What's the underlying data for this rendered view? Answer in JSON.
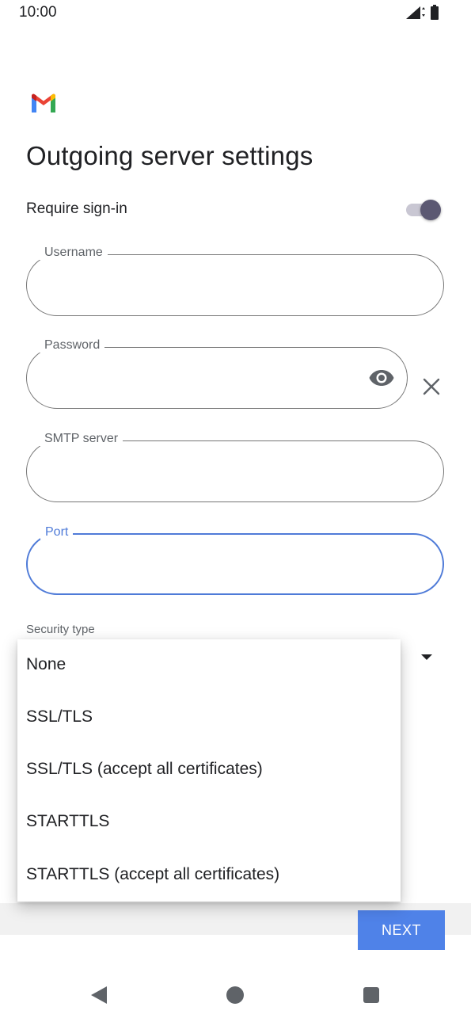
{
  "status_bar": {
    "time": "10:00",
    "icons": [
      "signal-icon",
      "battery-icon"
    ]
  },
  "app": {
    "logo_icon": "gmail-logo-icon"
  },
  "page": {
    "title": "Outgoing server settings"
  },
  "require_signin": {
    "label": "Require sign-in",
    "enabled": true
  },
  "fields": {
    "username": {
      "label": "Username",
      "value": ""
    },
    "password": {
      "label": "Password",
      "value": "",
      "visibility_icon": "eye-icon",
      "clear_icon": "close-icon"
    },
    "smtp_server": {
      "label": "SMTP server",
      "value": ""
    },
    "port": {
      "label": "Port",
      "value": "",
      "focused": true
    }
  },
  "security_type": {
    "label": "Security type",
    "dropdown_icon": "dropdown-arrow-icon",
    "options": [
      "None",
      "SSL/TLS",
      "SSL/TLS (accept all certificates)",
      "STARTTLS",
      "STARTTLS (accept all certificates)"
    ]
  },
  "actions": {
    "next_label": "NEXT"
  },
  "colors": {
    "accent": "#4f82e8",
    "focus": "#4f7bd8",
    "toggle_thumb": "#5b5872"
  },
  "nav_bar": {
    "icons": [
      "back-icon",
      "home-icon",
      "recents-icon"
    ]
  }
}
